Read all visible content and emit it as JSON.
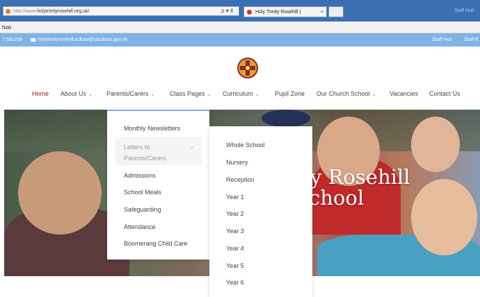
{
  "browser": {
    "url_proto": "http://www.",
    "url_rest": "holytrinityrosehill.org.uk/",
    "addr_tools": "ρ ▾ ¢",
    "tab_title": "Holy Trinity Rosehill |",
    "tab_close": "×",
    "window_controls": "Staff Hub",
    "find_text": "hoo"
  },
  "topbar": {
    "phone": "7 581239",
    "email": "holytrinityrosehill.school@stockton.gov.uk",
    "staff_hub": "Staff Hub",
    "staff_hub_2": "Staff E"
  },
  "nav": {
    "home": "Home",
    "about": "About Us",
    "parents": "Parents/Carers",
    "class_pages": "Class Pages",
    "curriculum": "Curriculum",
    "pupil_zone": "Pupil Zone",
    "church_school": "Our Church School",
    "vacancies": "Vacancies",
    "contact": "Contact Us",
    "caret": "⌄"
  },
  "hero": {
    "line1": "y Rosehill",
    "line2": "chool"
  },
  "parents_menu": {
    "monthly_newsletters": "Monthly Newsletters",
    "letters_line1": "Letters to",
    "letters_line2": "Parents/Carers",
    "admissions": "Admissions",
    "school_meals": "School Meals",
    "safeguarding": "Safeguarding",
    "attendance": "Attendance",
    "boomerang": "Boomerang Child Care"
  },
  "letters_menu": {
    "items": [
      "Whole School",
      "Nursery",
      "Reception",
      "Year 1",
      "Year 2",
      "Year 3",
      "Year 4",
      "Year 5",
      "Year 6"
    ]
  },
  "colors": {
    "topbar": "#7fb2e5",
    "active_nav": "#8b1a1a",
    "browser_frame": "#3a6fb3"
  }
}
